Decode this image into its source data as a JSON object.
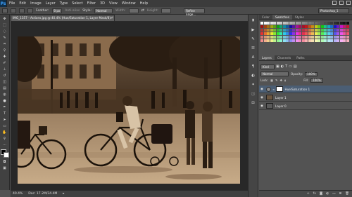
{
  "menubar": {
    "logo": "Ps",
    "items": [
      "File",
      "Edit",
      "Image",
      "Layer",
      "Type",
      "Select",
      "Filter",
      "3D",
      "View",
      "Window",
      "Help"
    ]
  },
  "options": {
    "feather_label": "Feather:",
    "feather_value": "0 px",
    "antialias_label": "Anti-alias",
    "style_label": "Style:",
    "style_value": "Normal",
    "width_label": "Width:",
    "height_label": "Height:",
    "refine_edge": "Refine Edge...",
    "workspace": "Photoshop_1"
  },
  "document": {
    "tab_title": "IMG_1357 - Actions.jpg @ 40.4% (Hue/Saturation 1, Layer Mask/8) *",
    "zoom": "40.4%",
    "doc_info": "Doc: 17.2M/34.4M"
  },
  "swatches_panel": {
    "tabs": [
      "Color",
      "Swatches",
      "Styles"
    ],
    "active_tab": "Swatches"
  },
  "layers_panel": {
    "tabs": [
      "Layers",
      "Channels",
      "Paths"
    ],
    "active_tab": "Layers",
    "kind_filter": "Kind",
    "blend_mode": "Normal",
    "opacity_label": "Opacity:",
    "opacity_value": "100%",
    "lock_label": "Lock:",
    "fill_label": "Fill:",
    "fill_value": "100%",
    "layers": [
      {
        "name": "Hue/Saturation 1",
        "type": "adjustment",
        "selected": true
      },
      {
        "name": "Layer 1",
        "type": "pixel",
        "selected": false
      },
      {
        "name": "Layer 0",
        "type": "pixel",
        "selected": false
      }
    ]
  },
  "colors": {
    "accent_selected": "#4b5e74",
    "sepia_dark": "#2a1d12",
    "sepia_light": "#b99a76"
  }
}
